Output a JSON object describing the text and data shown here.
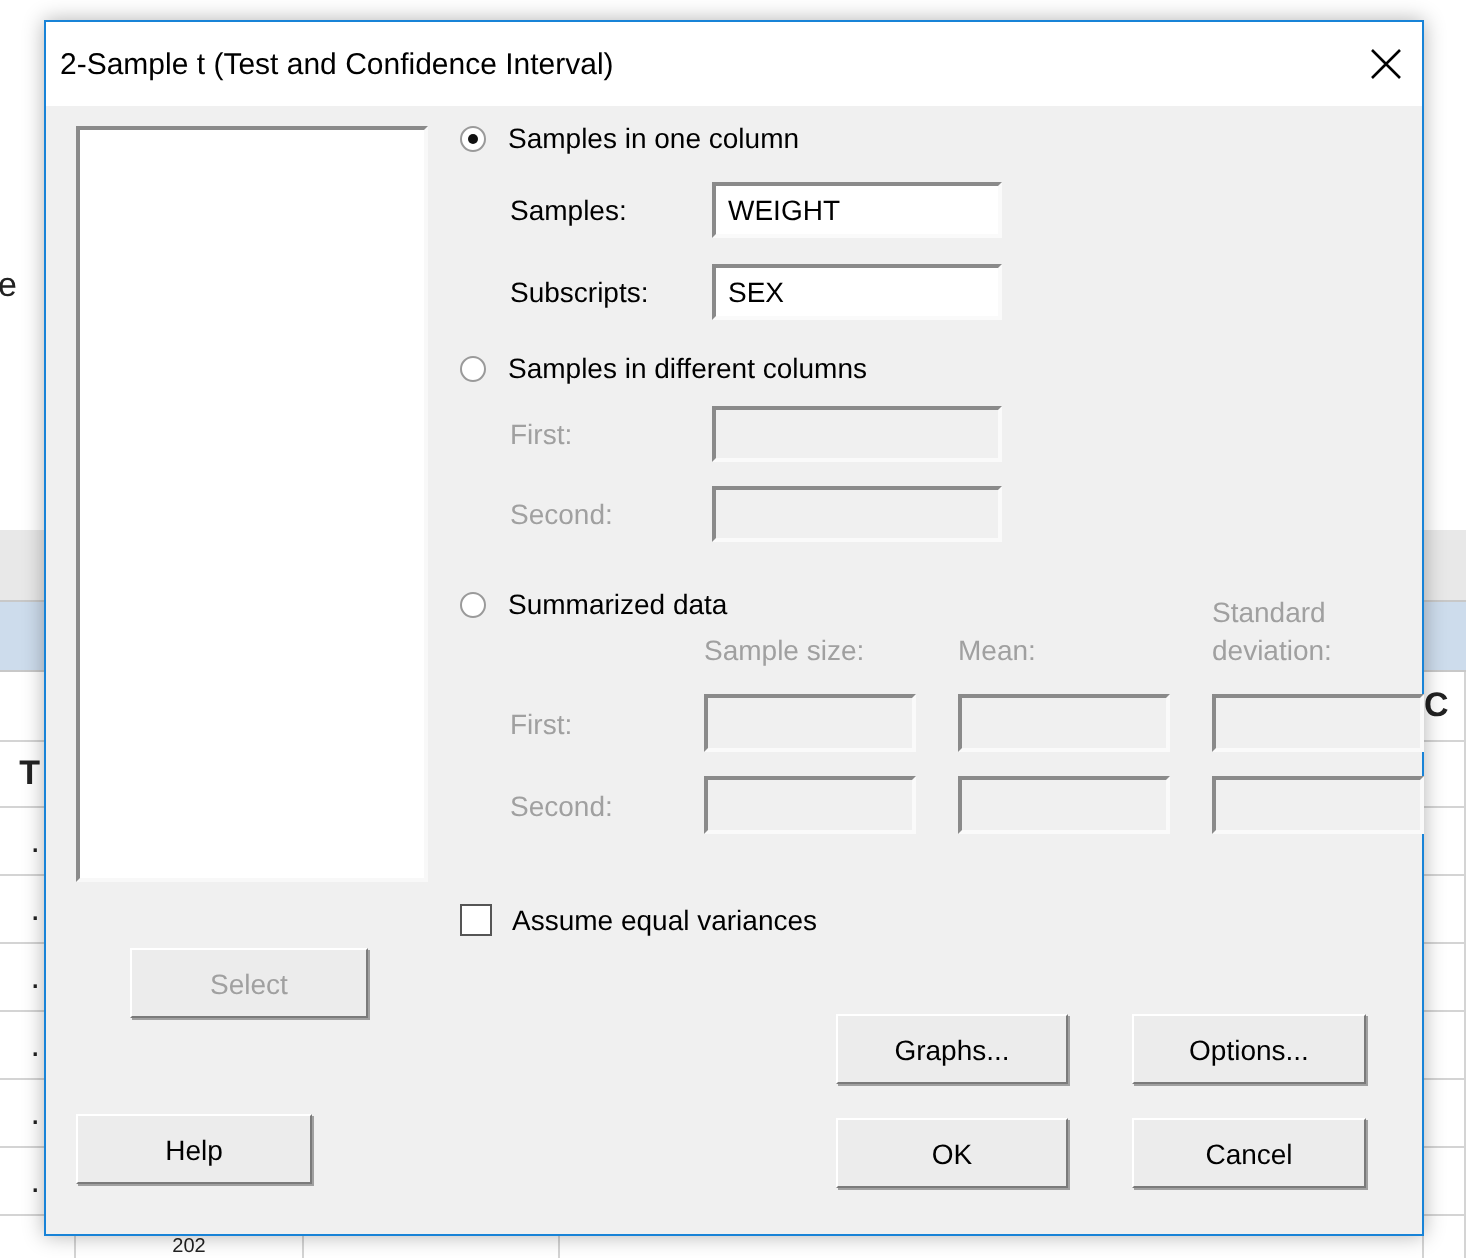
{
  "worksheet": {
    "side_label": "e",
    "right_header": "C",
    "rows": [
      {
        "left": "T"
      },
      {
        "left": "."
      },
      {
        "left": "."
      },
      {
        "left": "."
      },
      {
        "left": "."
      },
      {
        "left": "."
      },
      {
        "left": "."
      },
      {
        "second": "202"
      }
    ]
  },
  "window": {
    "title": "2-Sample t (Test and Confidence Interval)"
  },
  "select_button": {
    "label": "Select",
    "disabled": true
  },
  "modes": [
    {
      "kind": "pair",
      "label": "Samples in one column",
      "selected": true,
      "fields": [
        {
          "label": "Samples:",
          "value": "WEIGHT",
          "disabled": false
        },
        {
          "label": "Subscripts:",
          "value": "SEX",
          "disabled": false
        }
      ]
    },
    {
      "kind": "pair",
      "label": "Samples in different columns",
      "selected": false,
      "fields": [
        {
          "label": "First:",
          "disabled": true
        },
        {
          "label": "Second:",
          "disabled": true
        }
      ]
    },
    {
      "kind": "summary",
      "label": "Summarized data",
      "selected": false,
      "headers": [
        "Sample size:",
        "Mean:",
        "Standard deviation:"
      ],
      "rows": [
        {
          "label": "First:",
          "disabled": true
        },
        {
          "label": "Second:",
          "disabled": true
        }
      ]
    }
  ],
  "equal_variances": {
    "label": "Assume equal variances",
    "checked": false
  },
  "help_button": {
    "label": "Help"
  },
  "graphs_button": {
    "label": "Graphs..."
  },
  "options_button": {
    "label": "Options..."
  },
  "ok_button": {
    "label": "OK"
  },
  "cancel_button": {
    "label": "Cancel"
  }
}
